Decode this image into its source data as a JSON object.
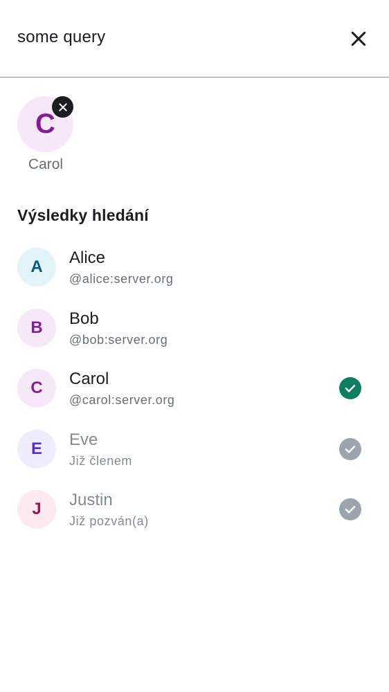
{
  "search": {
    "query": "some query"
  },
  "selected": [
    {
      "initial": "C",
      "name": "Carol",
      "bg": "#f6e8f8",
      "fg": "#851f91"
    }
  ],
  "section_title": "Výsledky hledání",
  "results": [
    {
      "initial": "A",
      "name": "Alice",
      "subtitle": "@alice:server.org",
      "bg": "#e2f4fa",
      "fg": "#0b5782",
      "state": "none"
    },
    {
      "initial": "B",
      "name": "Bob",
      "subtitle": "@bob:server.org",
      "bg": "#f6e8f8",
      "fg": "#851f91",
      "state": "none"
    },
    {
      "initial": "C",
      "name": "Carol",
      "subtitle": "@carol:server.org",
      "bg": "#f6e8f8",
      "fg": "#851f91",
      "state": "selected"
    },
    {
      "initial": "E",
      "name": "Eve",
      "subtitle": "Již členem",
      "bg": "#f0ecff",
      "fg": "#5a2ec6",
      "state": "member"
    },
    {
      "initial": "J",
      "name": "Justin",
      "subtitle": "Již pozván(a)",
      "bg": "#fdeaf0",
      "fg": "#9b1649",
      "state": "invited"
    }
  ],
  "colors": {
    "check_selected": "#0e7d62",
    "check_disabled": "#9ea4ad"
  },
  "icons": {
    "close": "close-icon",
    "remove": "close-icon",
    "check": "check-icon"
  }
}
